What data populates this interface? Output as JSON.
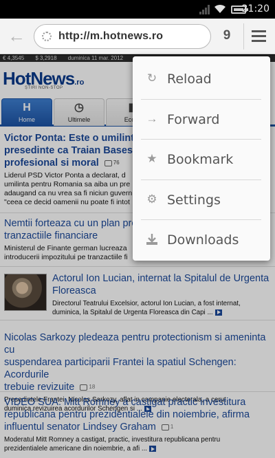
{
  "status_bar": {
    "time": "21:20",
    "icons": [
      "signal-icon",
      "wifi-icon",
      "battery-icon"
    ]
  },
  "browser": {
    "url": "http://m.hotnews.ro",
    "tab_count": "9",
    "icons": {
      "back": "arrow-left-icon",
      "menu": "hamburger-menu-icon",
      "site": "page-icon"
    }
  },
  "page": {
    "ticker": [
      "€ 4,3545",
      "$ 3,2918",
      "duminica 11 mar. 2012"
    ],
    "logo": {
      "main": "HotNews",
      "ro": ".ro",
      "sub": "ȘTIRI NON-STOP"
    },
    "nav_tabs": [
      {
        "label": "Home",
        "icon": "H"
      },
      {
        "label": "Ultimele",
        "icon": "◷"
      },
      {
        "label": "Econ",
        "icon": "▮"
      }
    ],
    "articles": [
      {
        "title": "Victor Ponta: Este o umilinta ... presedinte ca Traian Basescu ... profesional si moral",
        "title_lines": [
          "Victor Ponta: Este o umilinta",
          "presedinte ca Traian Basescu",
          "profesional si moral"
        ],
        "comments": "76",
        "summary_lines": [
          "Liderul PSD Victor Ponta a declarat, d",
          "umilinta pentru Romania sa aiba un pre",
          "adaugand ca nu vrea sa fi niciun guvern PSD",
          "\"ceea ce decid oamenii nu poate fi intot"
        ]
      },
      {
        "title_lines": [
          "Nemtii forteaza cu un plan propi",
          "tranzactiile financiare"
        ],
        "summary_lines": [
          "Ministerul de Finante german lucreaza",
          "introducerii impozitului pe tranzactiile fi"
        ]
      },
      {
        "title_lines": [
          "Actorul Ion Lucian, internat la Spitalul de Urgenta",
          "Floreasca"
        ],
        "summary_lines": [
          "Directorul Teatrului Excelsior, actorul Ion Lucian, a fost internat,",
          "duminica, la Spitalul de Urgenta Floreasca din Capi ..."
        ]
      },
      {
        "title_lines": [
          "Nicolas Sarkozy pledeaza pentru protectionism si ameninta cu",
          "suspendarea participarii Frantei la spatiul Schengen: Acordurile",
          "trebuie revizuite"
        ],
        "comments": "18",
        "summary_lines": [
          "Presedintele Frantei, Nicolas Sarkozy, aflat in campanie electorala, a cerut",
          "duminica revizuirea acordurilor Schengen si ..."
        ]
      },
      {
        "title_lines": [
          "VIDEO SUA: Mitt Romney a castigat practic investitura",
          "republicana pentru prezidentialele din noiembrie, afirma",
          "influentul senator Lindsey Graham"
        ],
        "comments": "1",
        "summary_lines": [
          "Moderatul Mitt Romney a castigat, practic, investitura republicana pentru",
          "prezidentialele americane din noiembrie, a afi ..."
        ]
      }
    ]
  },
  "menu": {
    "items": [
      {
        "label": "Reload",
        "icon": "reload-icon"
      },
      {
        "label": "Forward",
        "icon": "forward-arrow-icon"
      },
      {
        "label": "Bookmark",
        "icon": "star-icon"
      },
      {
        "label": "Settings",
        "icon": "gear-icon"
      },
      {
        "label": "Downloads",
        "icon": "download-icon"
      }
    ]
  },
  "colors": {
    "link": "#1c4a9c",
    "nav_active": "#1d54a6",
    "logo_accent": "#f2a900"
  }
}
